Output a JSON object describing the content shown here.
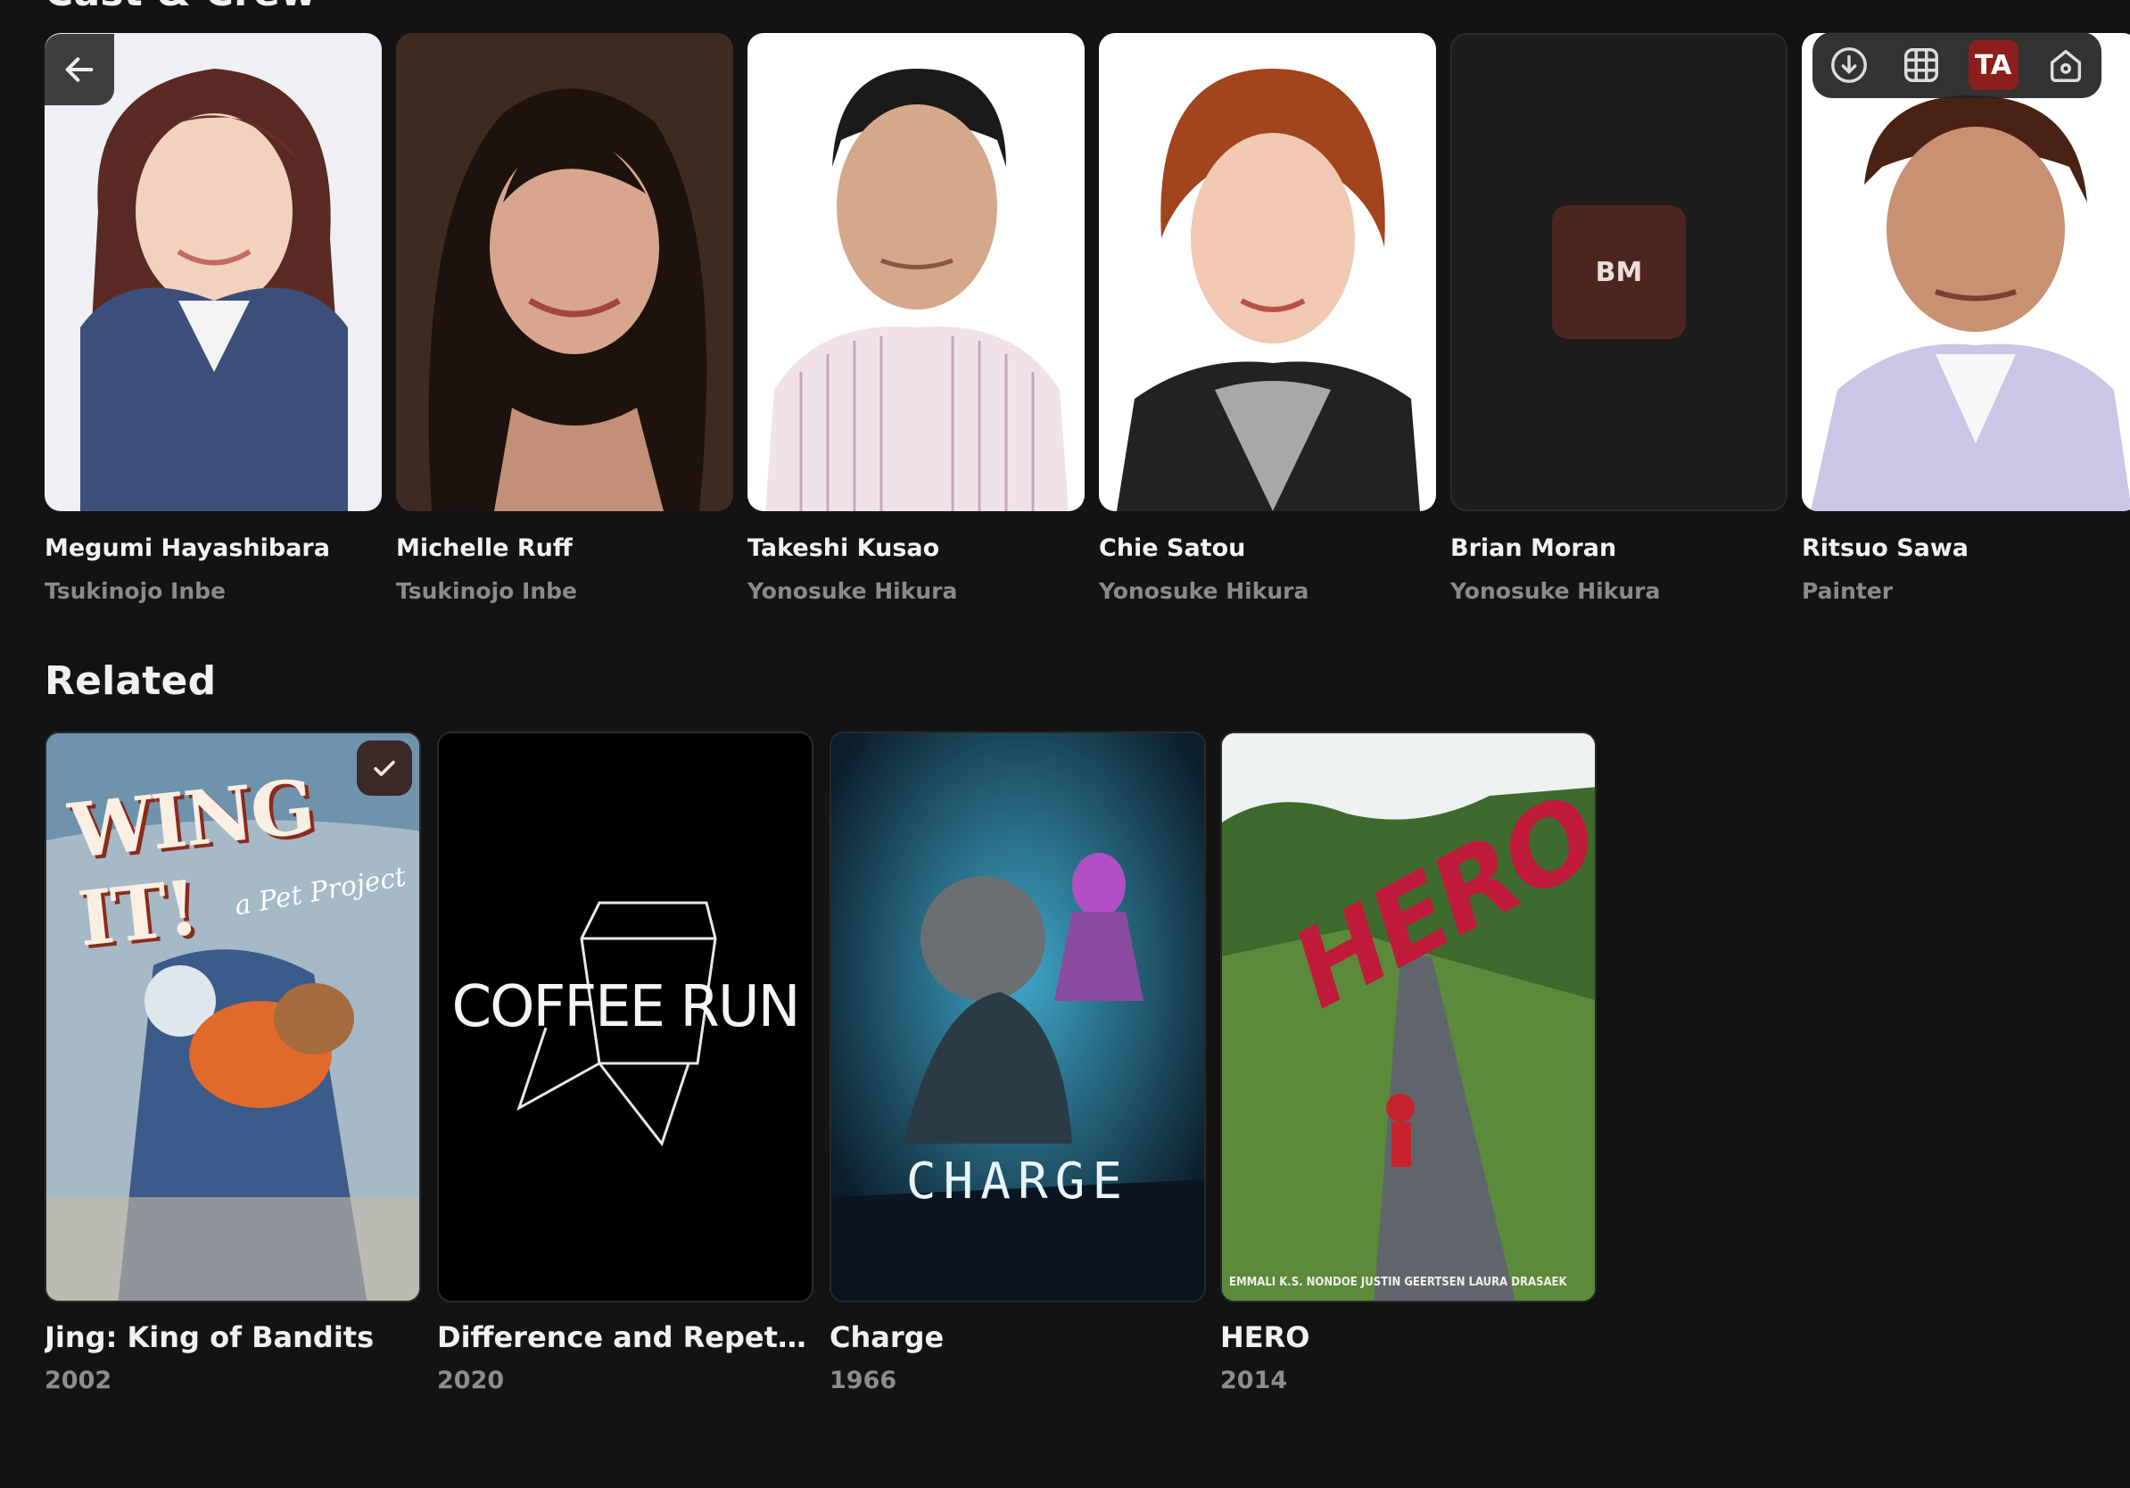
{
  "cast_section": {
    "title": "Cast & Crew"
  },
  "cast": [
    {
      "name": "Megumi Hayashibara",
      "role": "Tsukinojo Inbe"
    },
    {
      "name": "Michelle Ruff",
      "role": "Tsukinojo Inbe"
    },
    {
      "name": "Takeshi Kusao",
      "role": "Yonosuke Hikura"
    },
    {
      "name": "Chie Satou",
      "role": "Yonosuke Hikura"
    },
    {
      "name": "Brian Moran",
      "role": "Yonosuke Hikura",
      "initials": "BM"
    },
    {
      "name": "Ritsuo Sawa",
      "role": "Painter"
    }
  ],
  "related_section": {
    "title": "Related"
  },
  "related": [
    {
      "title": "Jing: King of Bandits",
      "year": "2002",
      "poster_text": "WING IT!",
      "poster_subtext": "a Pet Project",
      "watched": true
    },
    {
      "title": "Difference and Repetitio...",
      "year": "2020",
      "poster_text": "COFFEE RUN"
    },
    {
      "title": "Charge",
      "year": "1966",
      "poster_text": "CHARGE"
    },
    {
      "title": "HERO",
      "year": "2014",
      "poster_text": "HERO",
      "poster_credits": "EMMALI K.S. NONDOE   JUSTIN GEERTSEN   LAURA DRASAEK"
    }
  ],
  "toolbar": {
    "avatar_initials": "TA"
  },
  "icons": {
    "back": "arrow-left-icon",
    "download": "download-icon",
    "grid": "grid-icon",
    "home": "home-icon",
    "check": "check-icon"
  },
  "colors": {
    "background": "#131313",
    "accent": "#8c1f1d",
    "initials_badge": "#4e2420"
  }
}
